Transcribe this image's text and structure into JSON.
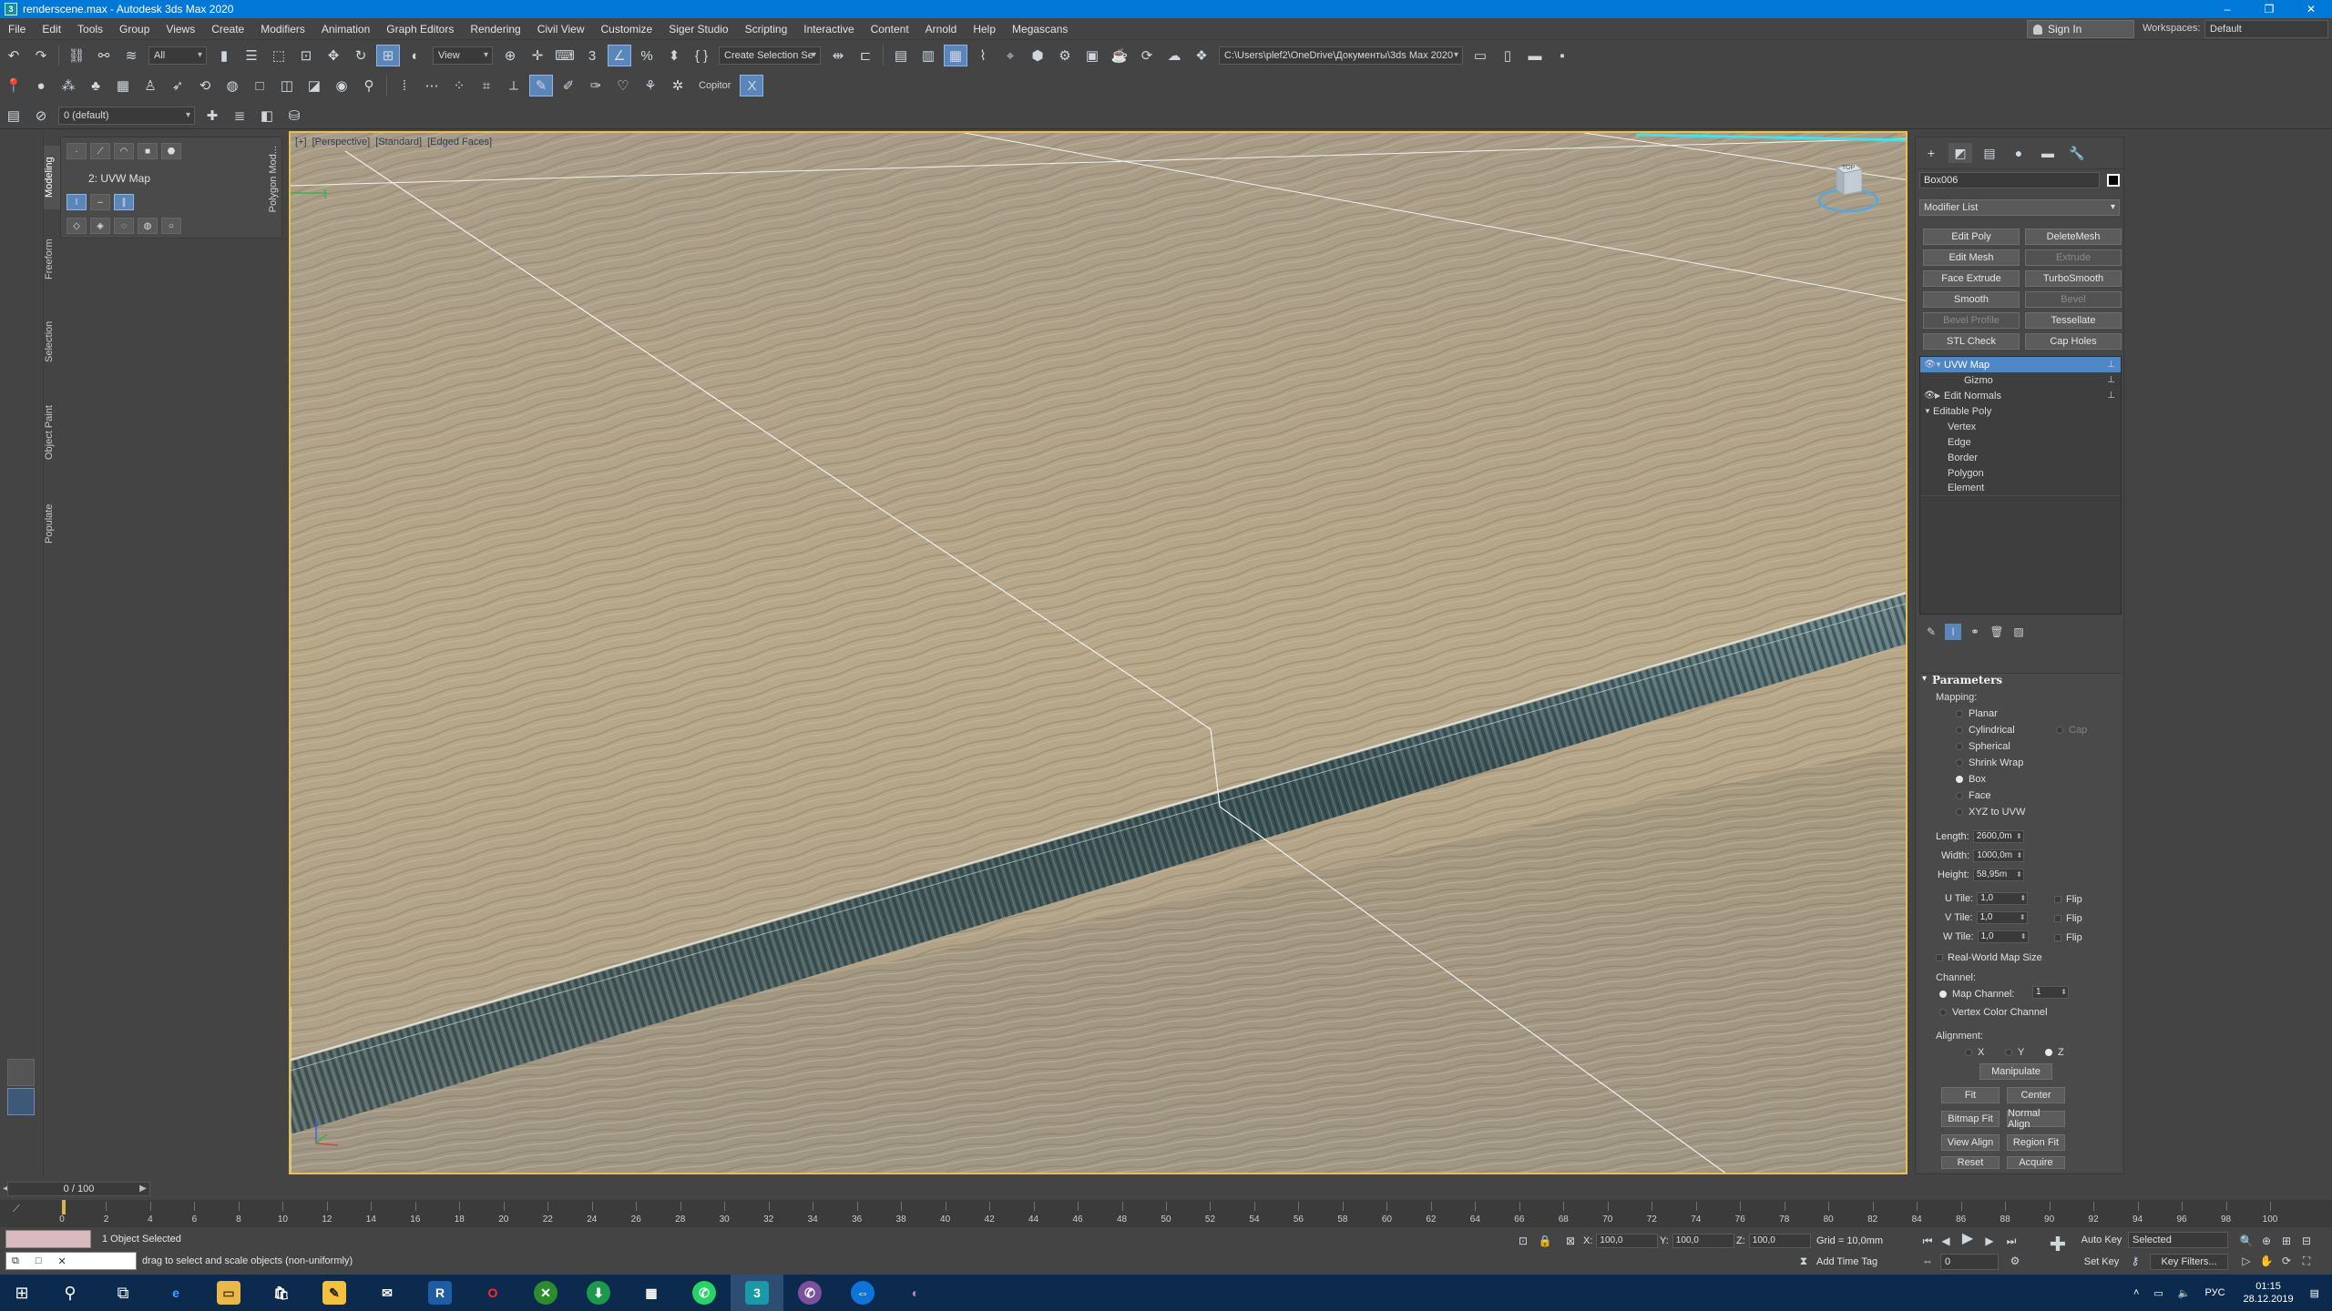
{
  "window": {
    "title": "renderscene.max - Autodesk 3ds Max 2020",
    "app_icon_letter": "3",
    "controls": [
      "–",
      "❐",
      "✕"
    ]
  },
  "menu": {
    "items": [
      "File",
      "Edit",
      "Tools",
      "Group",
      "Views",
      "Create",
      "Modifiers",
      "Animation",
      "Graph Editors",
      "Rendering",
      "Civil View",
      "Customize",
      "Siger Studio",
      "Scripting",
      "Interactive",
      "Content",
      "Arnold",
      "Help",
      "Megascans"
    ],
    "sign_in": "Sign In",
    "workspaces_label": "Workspaces:",
    "workspace_value": "Default"
  },
  "toolbar": {
    "filter_value": "All",
    "refcoord_value": "View",
    "selection_set_placeholder": "Create Selection Se",
    "project_path": "C:\\Users\\plef2\\OneDrive\\Документы\\3ds Max 2020",
    "copitor_label": "Copitor",
    "layer_value": "0 (default)"
  },
  "left_ribbon": {
    "tabs": [
      "Modeling",
      "Freeform",
      "Selection",
      "Object Paint",
      "Populate"
    ],
    "modifier_label": "2: UVW Map",
    "side_label": "Polygon Mod..."
  },
  "viewport": {
    "label_parts": [
      "[+]",
      "[Perspective]",
      "[Standard]",
      "[Edged Faces]"
    ],
    "viewcube_label": "TOP"
  },
  "command_panel": {
    "object_name": "Box006",
    "modifier_list": "Modifier List",
    "modifier_buttons": [
      {
        "label": "Edit Poly",
        "enabled": true
      },
      {
        "label": "DeleteMesh",
        "enabled": true
      },
      {
        "label": "Edit Mesh",
        "enabled": true
      },
      {
        "label": "Extrude",
        "enabled": false
      },
      {
        "label": "Face Extrude",
        "enabled": true
      },
      {
        "label": "TurboSmooth",
        "enabled": true
      },
      {
        "label": "Smooth",
        "enabled": true
      },
      {
        "label": "Bevel",
        "enabled": false
      },
      {
        "label": "Bevel Profile",
        "enabled": false
      },
      {
        "label": "Tessellate",
        "enabled": true
      },
      {
        "label": "STL Check",
        "enabled": true
      },
      {
        "label": "Cap Holes",
        "enabled": true
      }
    ],
    "stack": [
      {
        "label": "UVW Map",
        "level": 0,
        "selected": true,
        "eye": true
      },
      {
        "label": "Gizmo",
        "level": 2,
        "selected": false,
        "eye": false
      },
      {
        "label": "Edit Normals",
        "level": 0,
        "selected": false,
        "eye": true
      },
      {
        "label": "Editable Poly",
        "level": 0,
        "selected": false,
        "eye": false
      },
      {
        "label": "Vertex",
        "level": 1,
        "selected": false,
        "eye": false
      },
      {
        "label": "Edge",
        "level": 1,
        "selected": false,
        "eye": false
      },
      {
        "label": "Border",
        "level": 1,
        "selected": false,
        "eye": false
      },
      {
        "label": "Polygon",
        "level": 1,
        "selected": false,
        "eye": false
      },
      {
        "label": "Element",
        "level": 1,
        "selected": false,
        "eye": false
      }
    ],
    "parameters": {
      "title": "Parameters",
      "mapping_label": "Mapping:",
      "mapping_options": [
        "Planar",
        "Cylindrical",
        "Spherical",
        "Shrink Wrap",
        "Box",
        "Face",
        "XYZ to UVW"
      ],
      "mapping_selected": "Box",
      "cap_label": "Cap",
      "length_label": "Length:",
      "length_value": "2600,0m",
      "width_label": "Width:",
      "width_value": "1000,0m",
      "height_label": "Height:",
      "height_value": "58,95m",
      "u_tile_label": "U Tile:",
      "u_tile_value": "1,0",
      "v_tile_label": "V Tile:",
      "v_tile_value": "1,0",
      "w_tile_label": "W Tile:",
      "w_tile_value": "1,0",
      "flip_label": "Flip",
      "real_world_label": "Real-World Map Size",
      "channel_label": "Channel:",
      "map_channel_label": "Map Channel:",
      "map_channel_value": "1",
      "vertex_color_label": "Vertex Color Channel",
      "alignment_label": "Alignment:",
      "axis_x": "X",
      "axis_y": "Y",
      "axis_z": "Z",
      "manipulate_label": "Manipulate",
      "fit_label": "Fit",
      "center_label": "Center",
      "bitmap_fit_label": "Bitmap Fit",
      "normal_align_label": "Normal Align",
      "view_align_label": "View Align",
      "region_fit_label": "Region Fit",
      "reset_label": "Reset",
      "acquire_label": "Acquire"
    }
  },
  "timeline": {
    "frame_display": "0 / 100",
    "ticks": [
      "0",
      "2",
      "4",
      "6",
      "8",
      "10",
      "12",
      "14",
      "16",
      "18",
      "20",
      "22",
      "24",
      "26",
      "28",
      "30",
      "32",
      "34",
      "36",
      "38",
      "40",
      "42",
      "44",
      "46",
      "48",
      "50",
      "52",
      "54",
      "56",
      "58",
      "60",
      "62",
      "64",
      "66",
      "68",
      "70",
      "72",
      "74",
      "76",
      "78",
      "80",
      "82",
      "84",
      "86",
      "88",
      "90",
      "92",
      "94",
      "96",
      "98",
      "100"
    ]
  },
  "status": {
    "selection": "1 Object Selected",
    "prompt": "drag to select and scale objects (non-uniformly)",
    "x_label": "X:",
    "x_value": "100,0",
    "y_label": "Y:",
    "y_value": "100,0",
    "z_label": "Z:",
    "z_value": "100,0",
    "grid": "Grid = 10,0mm",
    "add_time_tag": "Add Time Tag",
    "auto_key": "Auto Key",
    "set_key": "Set Key",
    "key_mode": "Selected",
    "key_filters": "Key Filters...",
    "current_frame": "0"
  },
  "taskbar": {
    "time": "01:15",
    "date": "28.12.2019",
    "lang": "РУС"
  },
  "colors": {
    "titlebar": "#0078d7",
    "selection_blue": "#4f86c6",
    "viewport_border": "#e5c34b",
    "wood": "#b2a48a"
  }
}
